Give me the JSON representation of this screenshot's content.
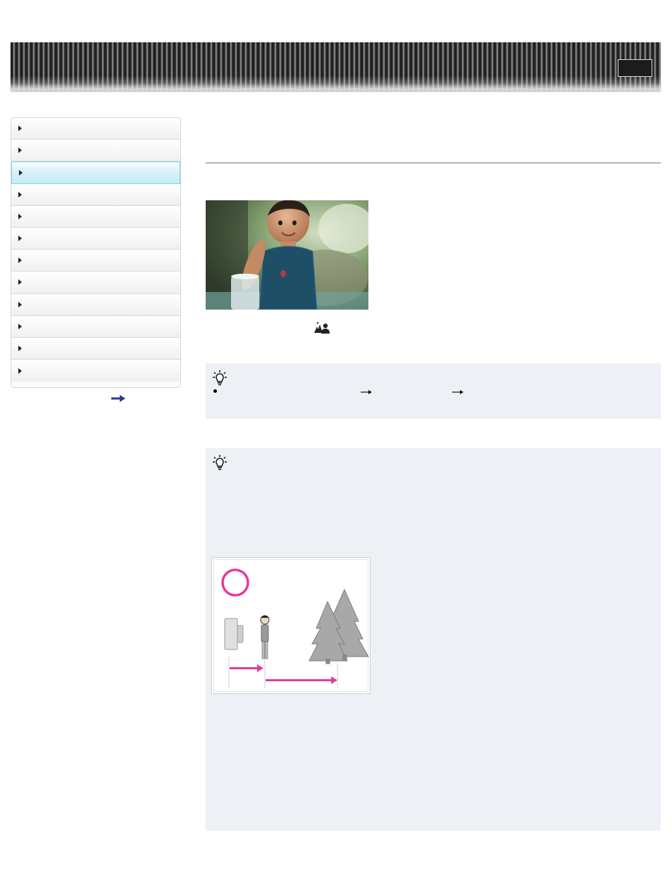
{
  "header": {
    "top_button_label": ""
  },
  "sidebar": {
    "items": [
      {
        "label": ""
      },
      {
        "label": ""
      },
      {
        "label": "",
        "active": true
      },
      {
        "label": ""
      },
      {
        "label": ""
      },
      {
        "label": ""
      },
      {
        "label": ""
      },
      {
        "label": ""
      },
      {
        "label": ""
      },
      {
        "label": ""
      },
      {
        "label": ""
      },
      {
        "label": ""
      }
    ],
    "more_icon": "right-arrow-icon"
  },
  "main": {
    "photo_alt": "",
    "scene_icon": "backlight-portrait-icon",
    "hint1": {
      "icon": "light-bulb-icon",
      "bullet_icon": "bullet-icon",
      "arrow_icon": "right-arrow-icon"
    },
    "hint2": {
      "icon": "light-bulb-icon"
    }
  },
  "colors": {
    "accent_active": "#c9ebf3",
    "hint_background": "#edf0f5",
    "diagram_magenta": "#e8399a"
  }
}
